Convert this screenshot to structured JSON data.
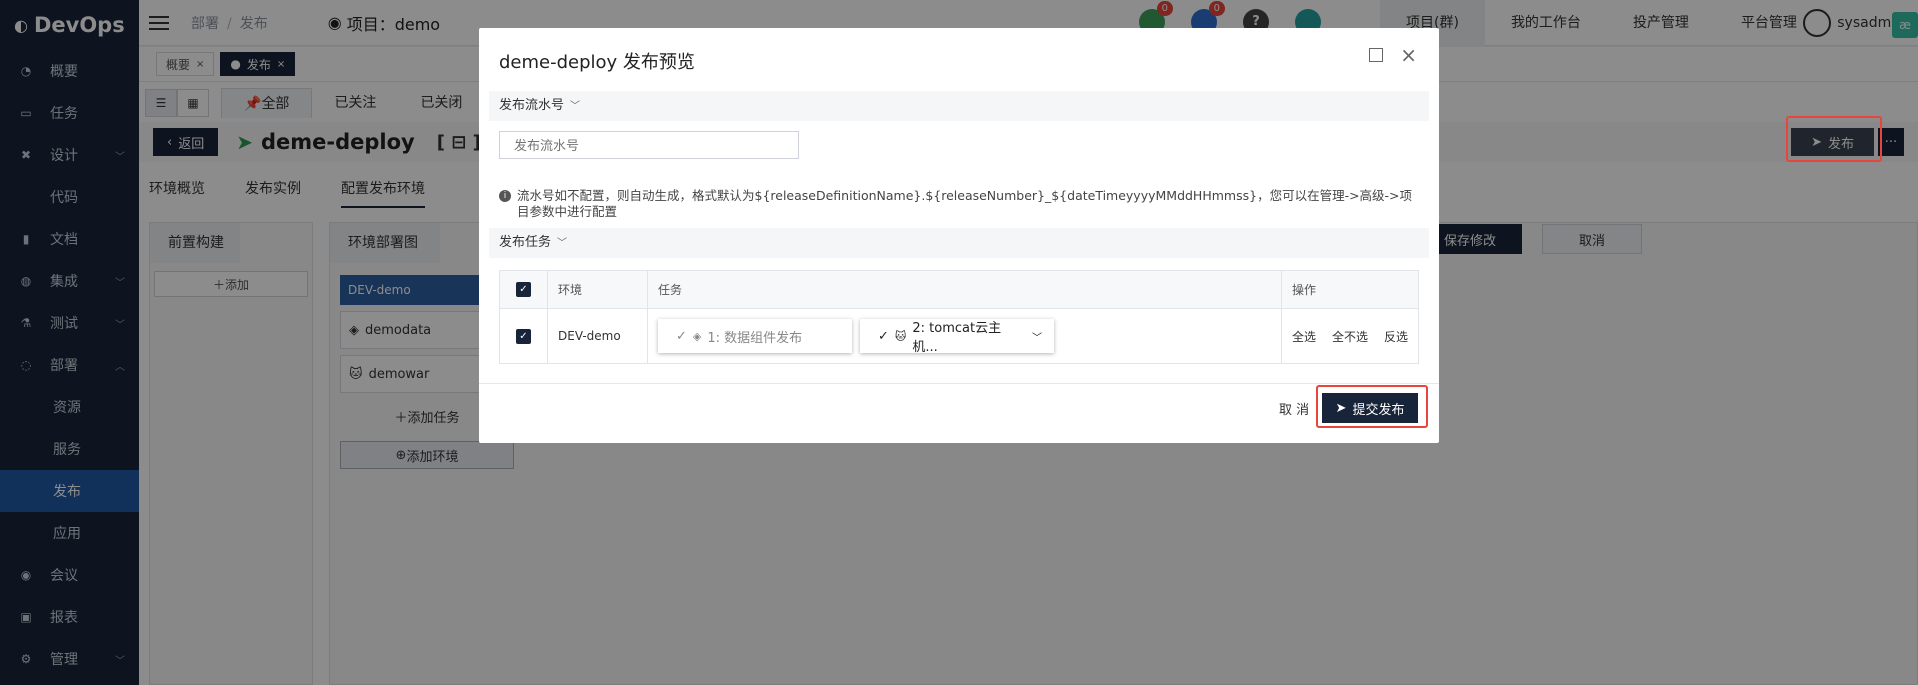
{
  "app": {
    "name": "DevOps"
  },
  "sidebar": {
    "items": [
      {
        "label": "概要",
        "icon": "dashboard-icon",
        "glyph": "◔"
      },
      {
        "label": "任务",
        "icon": "folder-icon",
        "glyph": "▭"
      },
      {
        "label": "设计",
        "icon": "tools-icon",
        "glyph": "✖"
      },
      {
        "label": "代码",
        "icon": "code-icon",
        "glyph": "</>"
      },
      {
        "label": "文档",
        "icon": "document-icon",
        "glyph": "▮"
      },
      {
        "label": "集成",
        "icon": "integration-icon",
        "glyph": "◍"
      },
      {
        "label": "测试",
        "icon": "flask-icon",
        "glyph": "⚗"
      },
      {
        "label": "部署",
        "icon": "deploy-icon",
        "glyph": "◌"
      }
    ],
    "sub": [
      "资源",
      "服务",
      "发布",
      "应用"
    ],
    "bottom": [
      {
        "label": "会议",
        "icon": "meeting-icon",
        "glyph": "◉"
      },
      {
        "label": "报表",
        "icon": "report-icon",
        "glyph": "▣"
      },
      {
        "label": "管理",
        "icon": "gear-icon",
        "glyph": "⚙"
      }
    ]
  },
  "topbar": {
    "breadcrumb": [
      "部署",
      "发布"
    ],
    "project_label": "项目：demo",
    "badges": [
      "0",
      "0"
    ],
    "menu": [
      "项目(群)",
      "我的工作台",
      "投产管理",
      "平台管理"
    ],
    "user": "sysadmin"
  },
  "page_tabs": [
    "概要",
    "发布"
  ],
  "filter_tabs": [
    "全部",
    "已关注",
    "已关闭"
  ],
  "header": {
    "back": "返回",
    "app_name": "deme-deploy",
    "bracket": "[ ⊟ ]",
    "publish": "发布",
    "more": "···"
  },
  "subtabs": [
    "环境概览",
    "发布实例",
    "配置发布环境"
  ],
  "left_panel": {
    "title": "前置构建",
    "add": "添加"
  },
  "mid_panel": {
    "title": "环境部署图",
    "env": "DEV-demo",
    "tasks": [
      "demodata",
      "demowar"
    ],
    "add_task": "添加任务",
    "add_env": "添加环境",
    "save": "保存修改",
    "cancel": "取消"
  },
  "modal": {
    "title": "deme-deploy 发布预览",
    "section1": "发布流水号",
    "input_placeholder": "发布流水号",
    "note": "流水号如不配置，则自动生成，格式默认为${releaseDefinitionName}.${releaseNumber}_${dateTimeyyyyMMddHHmmss}，您可以在管理->高级->项目参数中进行配置",
    "section2": "发布任务",
    "table": {
      "headers": [
        "环境",
        "任务",
        "操作"
      ],
      "row": {
        "env": "DEV-demo",
        "task1": "1: 数据组件发布",
        "task2": "2: tomcat云主机...",
        "actions": [
          "全选",
          "全不选",
          "反选"
        ]
      }
    },
    "cancel": "取 消",
    "submit": "提交发布"
  }
}
